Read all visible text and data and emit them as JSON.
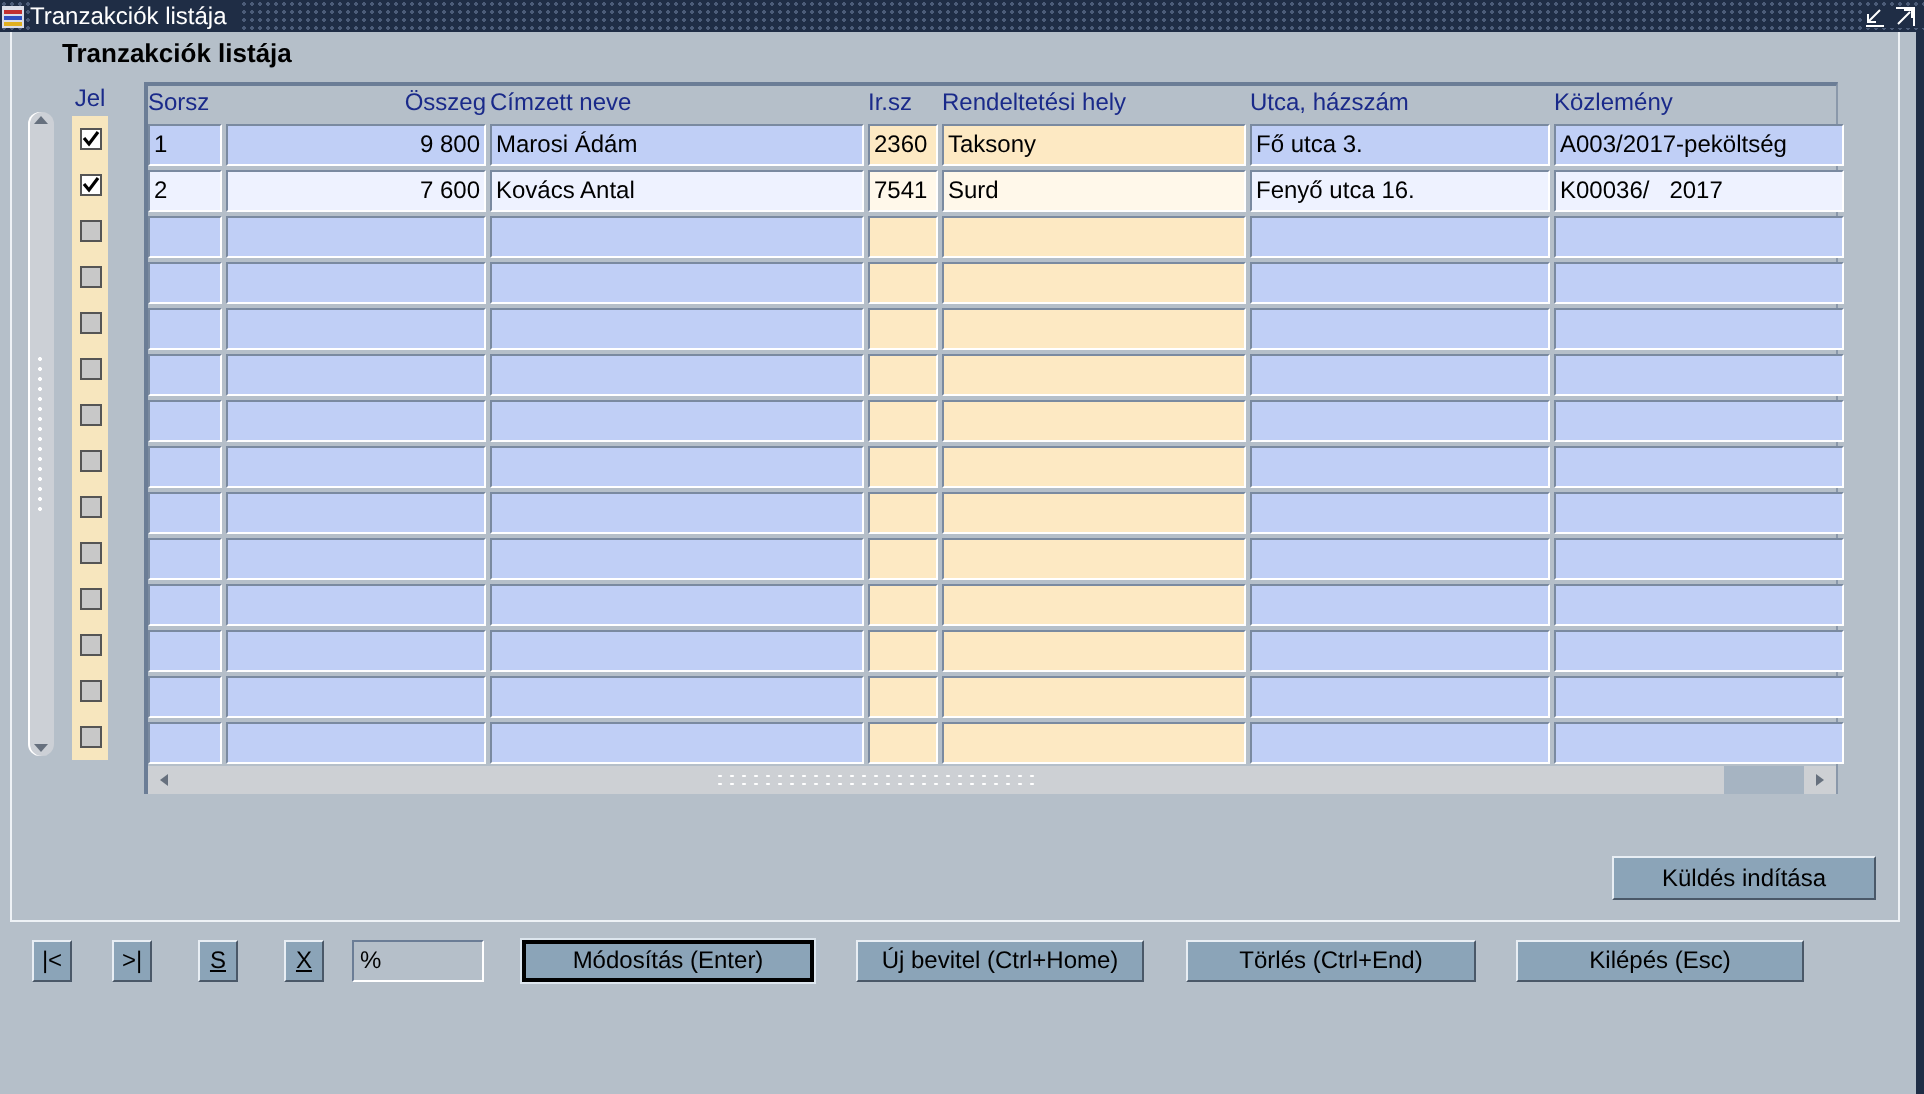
{
  "window": {
    "title": "Tranzakciók listája"
  },
  "panel": {
    "title": "Tranzakciók listája"
  },
  "table": {
    "mark_column": "Jel",
    "columns": [
      {
        "label": "Sorsz",
        "kind": "plain"
      },
      {
        "label": "Összeg",
        "kind": "amount"
      },
      {
        "label": "Címzett neve",
        "kind": "plain"
      },
      {
        "label": "Ir.sz",
        "kind": "warm"
      },
      {
        "label": "Rendeltetési hely",
        "kind": "warm"
      },
      {
        "label": "Utca, házszám",
        "kind": "plain"
      },
      {
        "label": "Közlemény",
        "kind": "plain"
      }
    ],
    "rows": [
      {
        "checked": true,
        "current": false,
        "cells": [
          "1",
          "9 800",
          "Marosi Ádám",
          "2360",
          "Taksony",
          "Fő utca 3.",
          "A003/2017-peköltség"
        ]
      },
      {
        "checked": true,
        "current": true,
        "cells": [
          "2",
          "7 600",
          "Kovács Antal",
          "7541",
          "Surd",
          "Fenyő utca 16.",
          "K00036/   2017"
        ]
      },
      {
        "checked": false,
        "current": false
      },
      {
        "checked": false,
        "current": false
      },
      {
        "checked": false,
        "current": false
      },
      {
        "checked": false,
        "current": false
      },
      {
        "checked": false,
        "current": false
      },
      {
        "checked": false,
        "current": false
      },
      {
        "checked": false,
        "current": false
      },
      {
        "checked": false,
        "current": false
      },
      {
        "checked": false,
        "current": false
      },
      {
        "checked": false,
        "current": false
      },
      {
        "checked": false,
        "current": false
      },
      {
        "checked": false,
        "current": false
      }
    ]
  },
  "send_button": {
    "label": "Küldés indítása"
  },
  "toolbar": {
    "nav_buttons": [
      {
        "label": "|<",
        "underlined": false
      },
      {
        "label": ">|",
        "underlined": false
      },
      {
        "label": "S",
        "underlined": true
      },
      {
        "label": "X",
        "underlined": true
      }
    ],
    "filter_field": {
      "value": "%"
    },
    "buttons": [
      {
        "label": "Módosítás (Enter)",
        "default": true
      },
      {
        "label": "Új bevitel (Ctrl+Home)",
        "default": false
      },
      {
        "label": "Törlés (Ctrl+End)",
        "default": false
      },
      {
        "label": "Kilépés (Esc)",
        "default": false
      }
    ]
  }
}
